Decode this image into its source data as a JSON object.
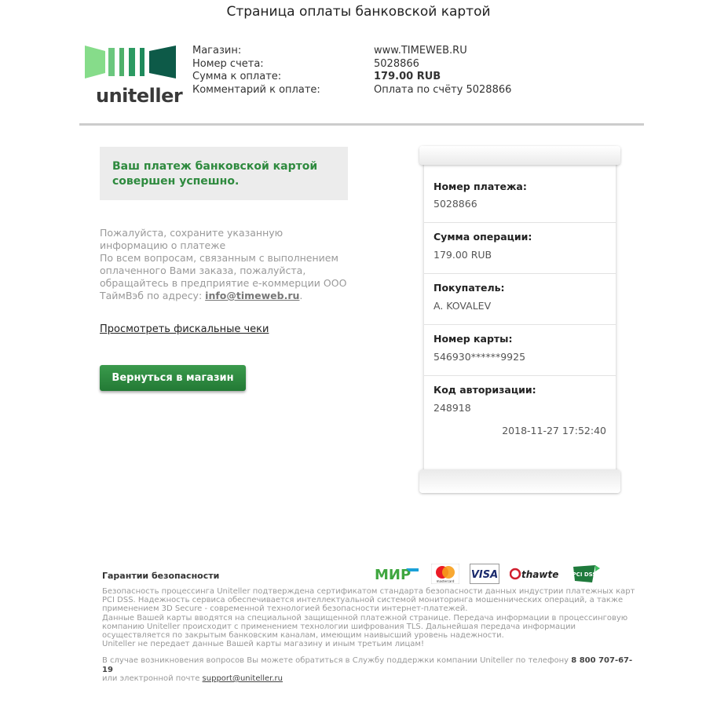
{
  "page": {
    "title": "Страница оплаты банковской картой"
  },
  "logo": {
    "text": "uniteller",
    "colors": [
      "#86dc8a",
      "#52b26b",
      "#1c8a5e",
      "#0d5a48"
    ]
  },
  "order_info": {
    "labels": [
      "Магазин:",
      "Номер счета:",
      "Сумма к оплате:",
      "Комментарий к оплате:"
    ],
    "values": [
      "www.TIMEWEB.RU",
      "5028866",
      "179.00 RUB",
      "Оплата по счёту 5028866"
    ]
  },
  "success": {
    "message": "Ваш платеж банковской картой совершен успешно."
  },
  "notice": {
    "line1": "Пожалуйста, сохраните указанную информацию о платеже",
    "line2": "По всем вопросам, связанным с выполнением оплаченного Вами заказа, пожалуйста, обращайтесь в предприятие е-коммерции ООО ТаймВэб по адресу:",
    "email": "info@timeweb.ru",
    "period": "."
  },
  "fiscal_link": "Просмотреть фискальные чеки",
  "back_button": "Вернуться в магазин",
  "receipt": {
    "rows": [
      {
        "label": "Номер платежа:",
        "value": "5028866"
      },
      {
        "label": "Сумма операции:",
        "value": "179.00 RUB"
      },
      {
        "label": "Покупатель:",
        "value": "A. KOVALEV"
      },
      {
        "label": "Номер карты:",
        "value": "546930******9925"
      },
      {
        "label": "Код авторизации:",
        "value": "248918"
      }
    ],
    "datetime": "2018-11-27 17:52:40"
  },
  "security": {
    "title": "Гарантии безопасности",
    "text1": "Безопасность процессинга Uniteller подтверждена сертификатом стандарта безопасности данных индустрии платежных карт PCI DSS. Надежность сервиса обеспечивается интеллектуальной системой мониторинга мошеннических операций, а также применением 3D Secure - современной технологией безопасности интернет-платежей.",
    "text2": "Данные Вашей карты вводятся на специальной защищенной платежной странице. Передача информации в процессинговую компанию Uniteller происходит с применением технологии шифрования TLS. Дальнейшая передача информации осуществляется по закрытым банковским каналам, имеющим наивысший уровень надежности.",
    "text3": "Uniteller не передает данные Вашей карты магазину и иным третьим лицам!",
    "badges": [
      "МИР",
      "mastercard",
      "VISA",
      "thawte",
      "PCI DSS"
    ]
  },
  "support": {
    "text_before": "В случае возникновения вопросов Вы можете обратиться в Службу поддержки компании Uniteller по телефону",
    "phone": "8 800 707-67-19",
    "text_after": "или электронной почте",
    "email": "support@uniteller.ru"
  }
}
